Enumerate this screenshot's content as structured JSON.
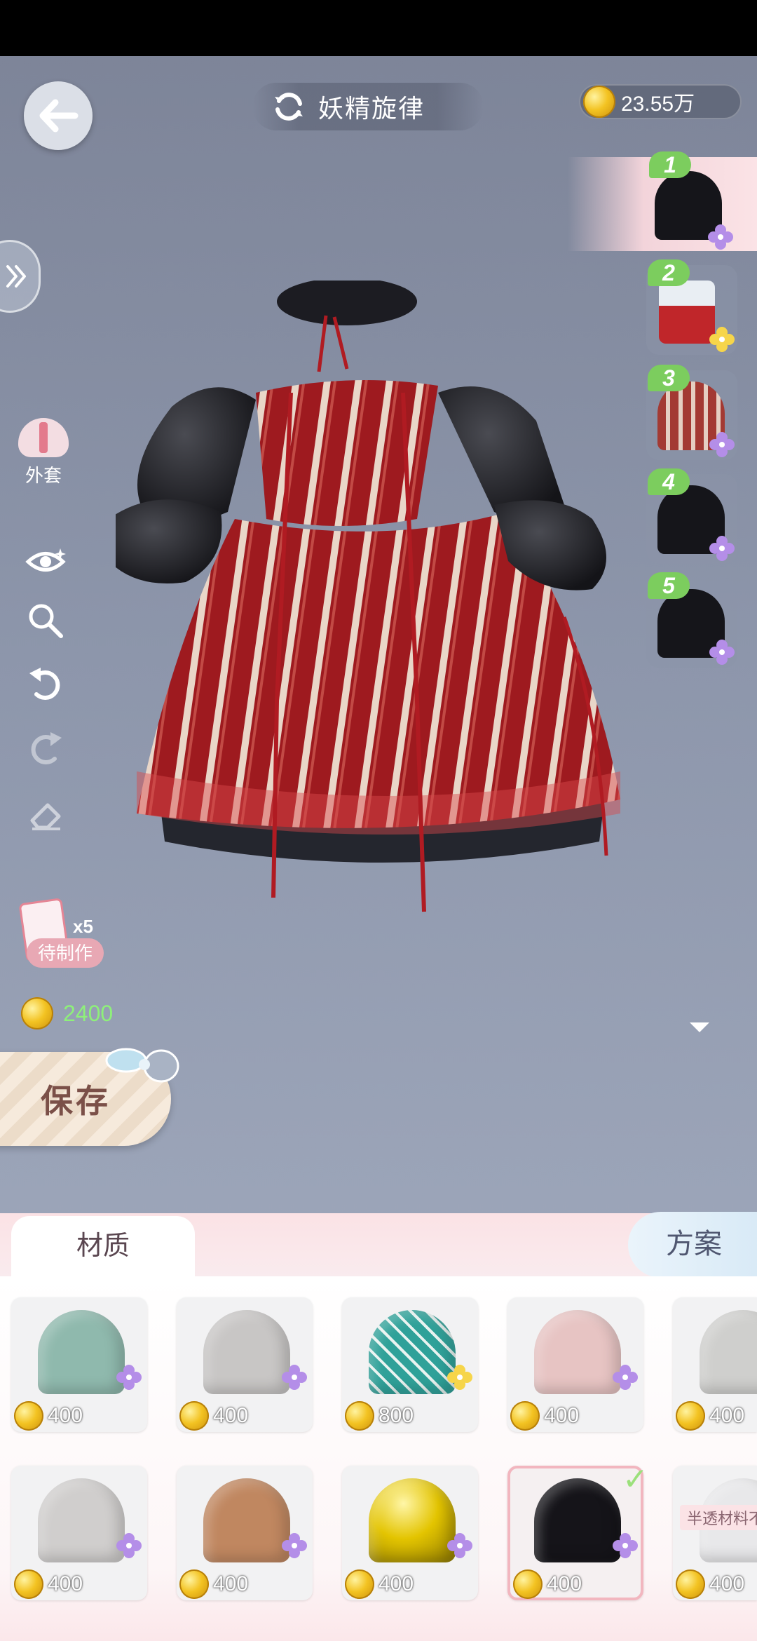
{
  "header": {
    "title": "妖精旋律",
    "coins": "23.55万"
  },
  "left_tools": {
    "category_label": "外套",
    "pending": {
      "count": "x5",
      "label": "待制作"
    },
    "cost": "2400",
    "save_label": "保存"
  },
  "slots": [
    {
      "num": "1",
      "color": "#15151a",
      "flower": "purple"
    },
    {
      "num": "2",
      "color": "#c0262a",
      "flower": "yellow"
    },
    {
      "num": "3",
      "color": "#a33a33",
      "flower": "purple"
    },
    {
      "num": "4",
      "color": "#15151a",
      "flower": "purple"
    },
    {
      "num": "5",
      "color": "#15151a",
      "flower": "purple"
    }
  ],
  "tabs": {
    "material": "材质",
    "plan": "方案"
  },
  "materials": [
    {
      "price": "400",
      "color": "#8fb9ad",
      "flower": "purple"
    },
    {
      "price": "400",
      "color": "#c8c6c5",
      "flower": "purple"
    },
    {
      "price": "800",
      "color": "#2fa199",
      "flower": "yellow"
    },
    {
      "price": "400",
      "color": "#e7c4c3",
      "flower": "purple"
    },
    {
      "price": "400",
      "color": "#cfcfcd",
      "flower": "none"
    },
    {
      "price": "400",
      "color": "#d0cecd",
      "flower": "purple"
    },
    {
      "price": "400",
      "color": "#c08760",
      "flower": "purple"
    },
    {
      "price": "400",
      "color": "#e3c400",
      "flower": "purple"
    },
    {
      "price": "400",
      "color": "#151419",
      "flower": "purple",
      "selected": true
    },
    {
      "price": "400",
      "color": "#e8e8ea",
      "flower": "none",
      "note": "半透材料不"
    }
  ],
  "colors": {
    "accent_green": "#7ccd5e",
    "coin_gold": "#f3c322",
    "cost_green": "#8ef07a"
  }
}
